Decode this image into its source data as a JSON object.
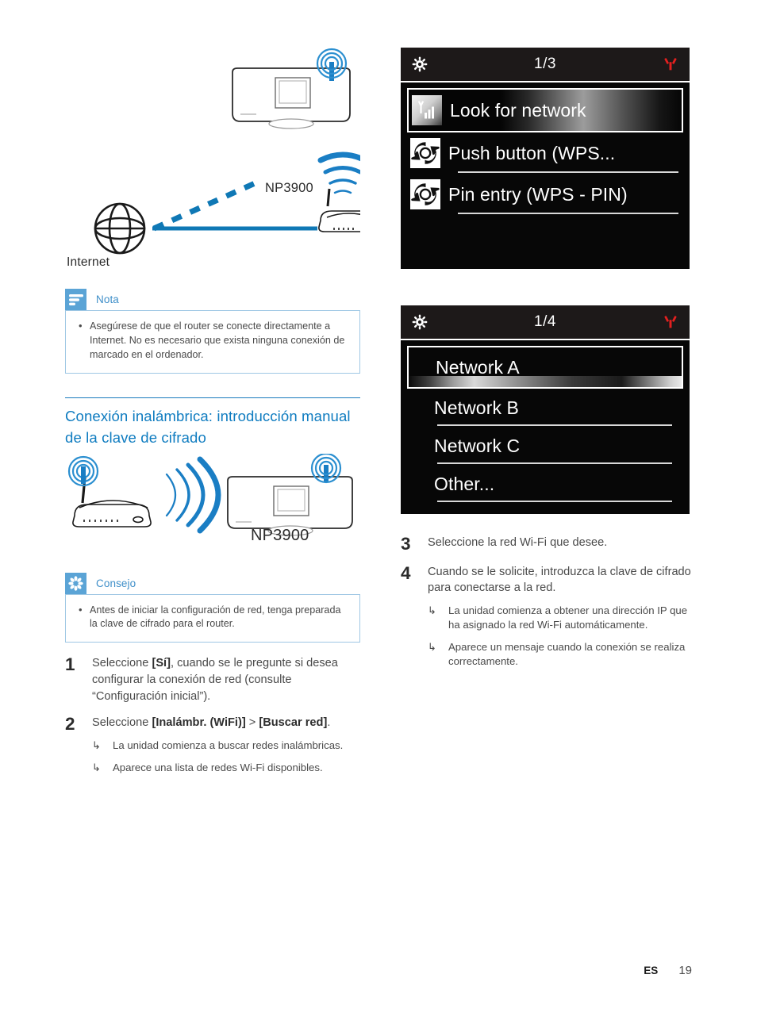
{
  "diagram_top": {
    "device_label": "NP3900",
    "internet_label": "Internet",
    "icons": {
      "globe": "globe-icon",
      "router": "wifi-router-icon",
      "speaker": "np3900-device-icon",
      "antenna_waves": "wifi-waves-icon"
    }
  },
  "note": {
    "badge_icon": "note-lines-icon",
    "title": "Nota",
    "items": [
      "Asegúrese de que el router se conecte directamente a Internet. No es necesario que exista ninguna conexión de marcado en el ordenador."
    ]
  },
  "section": {
    "heading": "Conexión inalámbrica: introducción manual de la clave de cifrado"
  },
  "diagram_mid": {
    "device_label": "NP3900",
    "icons": {
      "router": "wifi-router-icon",
      "speaker": "np3900-device-icon",
      "signal": "wifi-signal-arc-icon"
    }
  },
  "tip": {
    "badge_icon": "asterisk-star-icon",
    "title": "Consejo",
    "items": [
      "Antes de iniciar la configuración de red, tenga preparada la clave de cifrado para el router."
    ]
  },
  "steps_left": [
    {
      "num": "1",
      "text_parts": [
        {
          "t": "Seleccione ",
          "b": false
        },
        {
          "t": "[Sí]",
          "b": true
        },
        {
          "t": ", cuando se le pregunte si desea configurar la conexión de red (consulte “Configuración inicial”).",
          "b": false
        }
      ],
      "subs": []
    },
    {
      "num": "2",
      "text_parts": [
        {
          "t": "Seleccione ",
          "b": false
        },
        {
          "t": "[Inalámbr. (WiFi)]",
          "b": true
        },
        {
          "t": " > ",
          "b": false
        },
        {
          "t": "[Buscar red]",
          "b": true
        },
        {
          "t": ".",
          "b": false
        }
      ],
      "subs": [
        "La unidad comienza a buscar redes inalámbricas.",
        "Aparece una lista de redes Wi-Fi disponibles."
      ]
    }
  ],
  "lcd_panel_1": {
    "gear_icon": "gear-icon",
    "antenna_icon": "antenna-icon",
    "title": "1/3",
    "rows": [
      {
        "icon": "signal-bars-icon",
        "label": "Look for network",
        "selected": true
      },
      {
        "icon": "wps-icon",
        "label": "Push button (WPS...",
        "selected": false
      },
      {
        "icon": "wps-icon",
        "label": "Pin entry (WPS - PIN)",
        "selected": false
      }
    ]
  },
  "lcd_panel_2": {
    "gear_icon": "gear-icon",
    "antenna_icon": "antenna-icon",
    "title": "1/4",
    "rows": [
      {
        "label": "Network A",
        "selected": true
      },
      {
        "label": "Network B",
        "selected": false
      },
      {
        "label": "Network C",
        "selected": false
      },
      {
        "label": "Other...",
        "selected": false
      }
    ]
  },
  "steps_right": [
    {
      "num": "3",
      "text_parts": [
        {
          "t": "Seleccione la red Wi-Fi que desee.",
          "b": false
        }
      ],
      "subs": []
    },
    {
      "num": "4",
      "text_parts": [
        {
          "t": "Cuando se le solicite, introduzca la clave de cifrado para conectarse a la red.",
          "b": false
        }
      ],
      "subs": [
        "La unidad comienza a obtener una dirección IP que ha asignado la red Wi-Fi automáticamente.",
        "Aparece un mensaje cuando la conexión se realiza correctamente."
      ]
    }
  ],
  "footer": {
    "language": "ES",
    "page": "19"
  },
  "colors": {
    "accent_blue": "#0f7cc0",
    "badge_blue": "#5ba4d6",
    "callout_border": "#9fc7e4",
    "antenna_red": "#e3201f",
    "lcd_bg": "#070707",
    "lcd_header_bg": "#1d1919"
  }
}
